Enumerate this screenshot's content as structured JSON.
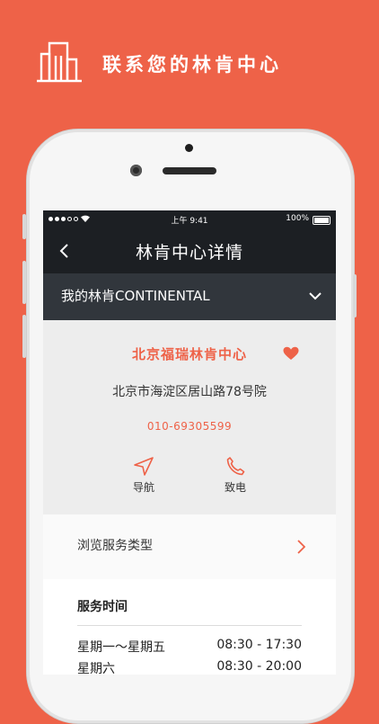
{
  "banner": {
    "title": "联系您的林肯中心",
    "icon": "building-icon"
  },
  "status_bar": {
    "time": "上午 9:41",
    "battery": "100%"
  },
  "nav": {
    "title": "林肯中心详情",
    "back_icon": "chevron-left-icon"
  },
  "brand_selector": {
    "label": "我的林肯CONTINENTAL",
    "icon": "chevron-down-icon"
  },
  "dealer": {
    "name": "北京福瑞林肯中心",
    "address": "北京市海淀区居山路78号院",
    "phone": "010-69305599",
    "favorite_icon": "heart-icon"
  },
  "actions": [
    {
      "label": "导航",
      "icon": "navigation-arrow-icon"
    },
    {
      "label": "致电",
      "icon": "phone-icon"
    }
  ],
  "service": {
    "label": "浏览服务类型",
    "icon": "chevron-right-icon"
  },
  "hours": {
    "title": "服务时间",
    "rows": [
      {
        "day": "星期一～星期五",
        "time": "08:30 - 17:30"
      },
      {
        "day": "星期六",
        "time": "08:30 - 20:00"
      }
    ]
  },
  "colors": {
    "accent": "#ee6248",
    "navbar": "#1c1f23",
    "brand_row": "#31363c"
  }
}
